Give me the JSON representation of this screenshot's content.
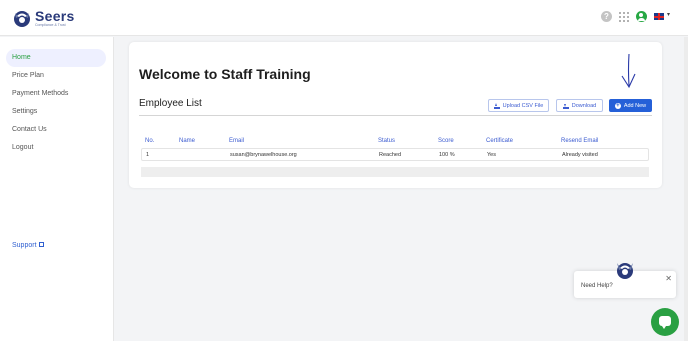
{
  "brand": {
    "name": "Seers",
    "tagline": "Compliance & Trust",
    "color": "#2a3a7a"
  },
  "header": {
    "icons": [
      "help-icon",
      "apps-grid-icon",
      "user-profile-icon",
      "uk-flag-icon",
      "chevron-down-icon"
    ],
    "help_glyph": "?",
    "caret_glyph": "▾"
  },
  "sidebar": {
    "items": [
      {
        "label": "Home",
        "active": true
      },
      {
        "label": "Price Plan",
        "active": false
      },
      {
        "label": "Payment Methods",
        "active": false
      },
      {
        "label": "Settings",
        "active": false
      },
      {
        "label": "Contact Us",
        "active": false
      },
      {
        "label": "Logout",
        "active": false
      }
    ],
    "support_label": "Support"
  },
  "main": {
    "page_title": "Welcome to Staff Training",
    "section_title": "Employee List",
    "buttons": {
      "upload": "Upload CSV File",
      "download": "Download",
      "add_new": "Add New",
      "plus_glyph": "+"
    },
    "table": {
      "headers": [
        "No.",
        "Name",
        "Email",
        "Status",
        "Score",
        "Certificate",
        "Resend Email"
      ],
      "rows": [
        [
          "1",
          "",
          "susan@brynawelhouse.org",
          "Reached",
          "100 %",
          "Yes",
          "Already visited"
        ]
      ]
    }
  },
  "help_widget": {
    "text": "Need Help?",
    "close_glyph": "✕"
  },
  "colors": {
    "accent_green": "#2aa043",
    "primary_blue": "#2560d8",
    "link_blue": "#3b5bd0"
  }
}
